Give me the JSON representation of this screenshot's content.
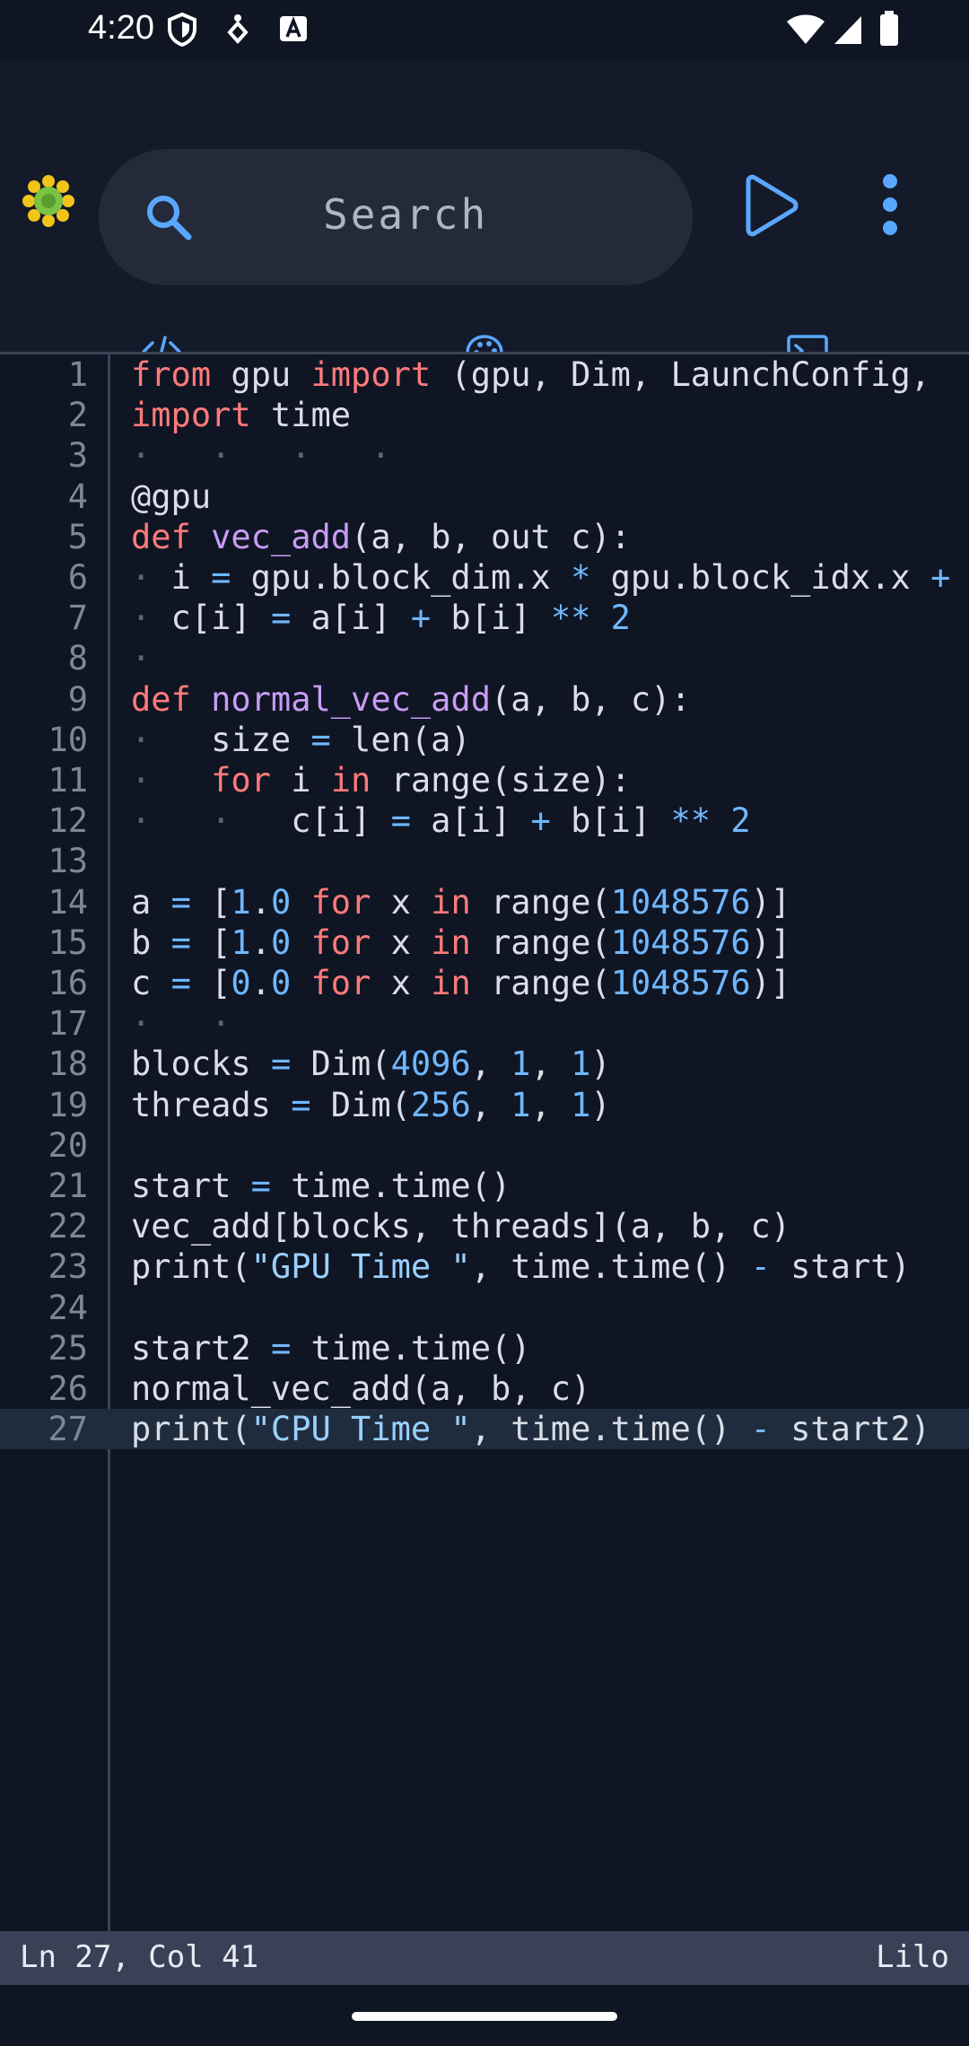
{
  "status_bar": {
    "time": "4:20"
  },
  "search": {
    "placeholder": "Search"
  },
  "tabs": [
    {
      "icon": "code-icon",
      "active": true
    },
    {
      "icon": "palette-icon",
      "active": false
    },
    {
      "icon": "terminal-icon",
      "active": false
    }
  ],
  "editor": {
    "active_line": 27,
    "lines": [
      [
        [
          "kw",
          "from"
        ],
        [
          "p",
          " gpu "
        ],
        [
          "kw",
          "import"
        ],
        [
          "p",
          " (gpu, Dim, LaunchConfig,"
        ]
      ],
      [
        [
          "kw",
          "import"
        ],
        [
          "p",
          " time"
        ]
      ],
      [
        [
          "ind",
          "·   ·   ·   ·"
        ]
      ],
      [
        [
          "p",
          "@gpu"
        ]
      ],
      [
        [
          "kw",
          "def"
        ],
        [
          "p",
          " "
        ],
        [
          "fn",
          "vec_add"
        ],
        [
          "p",
          "(a, b, out c):"
        ]
      ],
      [
        [
          "ind",
          "·"
        ],
        [
          "p",
          " i "
        ],
        [
          "op",
          "="
        ],
        [
          "p",
          " gpu.block_dim.x "
        ],
        [
          "op",
          "*"
        ],
        [
          "p",
          " gpu.block_idx.x "
        ],
        [
          "op",
          "+"
        ]
      ],
      [
        [
          "ind",
          "·"
        ],
        [
          "p",
          " c[i] "
        ],
        [
          "op",
          "="
        ],
        [
          "p",
          " a[i] "
        ],
        [
          "op",
          "+"
        ],
        [
          "p",
          " b[i] "
        ],
        [
          "op",
          "**"
        ],
        [
          "p",
          " "
        ],
        [
          "num",
          "2"
        ]
      ],
      [
        [
          "ind",
          "·"
        ]
      ],
      [
        [
          "kw",
          "def"
        ],
        [
          "p",
          " "
        ],
        [
          "fn",
          "normal_vec_add"
        ],
        [
          "p",
          "(a, b, c):"
        ]
      ],
      [
        [
          "ind",
          "·"
        ],
        [
          "p",
          "   size "
        ],
        [
          "op",
          "="
        ],
        [
          "p",
          " len(a)"
        ]
      ],
      [
        [
          "ind",
          "·"
        ],
        [
          "p",
          "   "
        ],
        [
          "kw",
          "for"
        ],
        [
          "p",
          " i "
        ],
        [
          "kw",
          "in"
        ],
        [
          "p",
          " range(size):"
        ]
      ],
      [
        [
          "ind",
          "·   ·"
        ],
        [
          "p",
          "   c[i] "
        ],
        [
          "op",
          "="
        ],
        [
          "p",
          " a[i] "
        ],
        [
          "op",
          "+"
        ],
        [
          "p",
          " b[i] "
        ],
        [
          "op",
          "**"
        ],
        [
          "p",
          " "
        ],
        [
          "num",
          "2"
        ]
      ],
      [],
      [
        [
          "p",
          "a "
        ],
        [
          "op",
          "="
        ],
        [
          "p",
          " ["
        ],
        [
          "num",
          "1"
        ],
        [
          "p",
          "."
        ],
        [
          "num",
          "0"
        ],
        [
          "p",
          " "
        ],
        [
          "kw",
          "for"
        ],
        [
          "p",
          " x "
        ],
        [
          "kw",
          "in"
        ],
        [
          "p",
          " range("
        ],
        [
          "num",
          "1048576"
        ],
        [
          "p",
          ")]"
        ]
      ],
      [
        [
          "p",
          "b "
        ],
        [
          "op",
          "="
        ],
        [
          "p",
          " ["
        ],
        [
          "num",
          "1"
        ],
        [
          "p",
          "."
        ],
        [
          "num",
          "0"
        ],
        [
          "p",
          " "
        ],
        [
          "kw",
          "for"
        ],
        [
          "p",
          " x "
        ],
        [
          "kw",
          "in"
        ],
        [
          "p",
          " range("
        ],
        [
          "num",
          "1048576"
        ],
        [
          "p",
          ")]"
        ]
      ],
      [
        [
          "p",
          "c "
        ],
        [
          "op",
          "="
        ],
        [
          "p",
          " ["
        ],
        [
          "num",
          "0"
        ],
        [
          "p",
          "."
        ],
        [
          "num",
          "0"
        ],
        [
          "p",
          " "
        ],
        [
          "kw",
          "for"
        ],
        [
          "p",
          " x "
        ],
        [
          "kw",
          "in"
        ],
        [
          "p",
          " range("
        ],
        [
          "num",
          "1048576"
        ],
        [
          "p",
          ")]"
        ]
      ],
      [
        [
          "ind",
          "·   ·"
        ]
      ],
      [
        [
          "p",
          "blocks "
        ],
        [
          "op",
          "="
        ],
        [
          "p",
          " Dim("
        ],
        [
          "num",
          "4096"
        ],
        [
          "p",
          ", "
        ],
        [
          "num",
          "1"
        ],
        [
          "p",
          ", "
        ],
        [
          "num",
          "1"
        ],
        [
          "p",
          ")"
        ]
      ],
      [
        [
          "p",
          "threads "
        ],
        [
          "op",
          "="
        ],
        [
          "p",
          " Dim("
        ],
        [
          "num",
          "256"
        ],
        [
          "p",
          ", "
        ],
        [
          "num",
          "1"
        ],
        [
          "p",
          ", "
        ],
        [
          "num",
          "1"
        ],
        [
          "p",
          ")"
        ]
      ],
      [],
      [
        [
          "p",
          "start "
        ],
        [
          "op",
          "="
        ],
        [
          "p",
          " time.time()"
        ]
      ],
      [
        [
          "p",
          "vec_add[blocks, threads](a, b, c)"
        ]
      ],
      [
        [
          "p",
          "print("
        ],
        [
          "str",
          "\"GPU Time \""
        ],
        [
          "p",
          ", time.time() "
        ],
        [
          "op",
          "-"
        ],
        [
          "p",
          " start)"
        ]
      ],
      [],
      [
        [
          "p",
          "start2 "
        ],
        [
          "op",
          "="
        ],
        [
          "p",
          " time.time()"
        ]
      ],
      [
        [
          "p",
          "normal_vec_add(a, b, c)"
        ]
      ],
      [
        [
          "p",
          "print("
        ],
        [
          "str",
          "\"CPU Time \""
        ],
        [
          "p",
          ", time.time() "
        ],
        [
          "op",
          "-"
        ],
        [
          "p",
          " start2)"
        ]
      ]
    ]
  },
  "footer": {
    "position": "Ln 27, Col 41",
    "language": "Lilo"
  },
  "colors": {
    "accent": "#5aa7ff",
    "background": "#0f1523",
    "keyword": "#ff7a7a",
    "function": "#c89cf5",
    "number": "#6fb7ff"
  }
}
